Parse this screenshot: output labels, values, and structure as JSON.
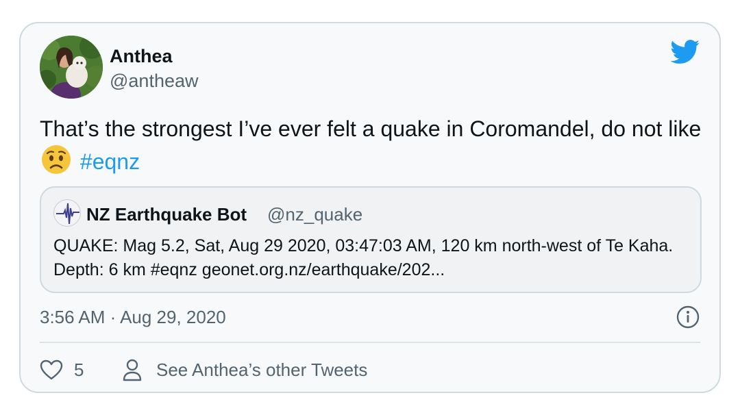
{
  "tweet": {
    "author_name": "Anthea",
    "author_handle": "@antheaw",
    "text_main": "That’s the strongest I’ve ever felt a quake in Coromandel, do not like",
    "emoji": "worried-face",
    "hashtag": "#eqnz",
    "timestamp": "3:56 AM · Aug 29, 2020"
  },
  "quote": {
    "author_name": "NZ Earthquake Bot",
    "author_handle": "@nz_quake",
    "text": "QUAKE: Mag 5.2, Sat, Aug 29 2020, 03:47:03 AM, 120 km north-west of Te Kaha. Depth: 6 km #eqnz geonet.org.nz/earthquake/202..."
  },
  "actions": {
    "like_count": "5",
    "other_tweets_label": "See Anthea’s other Tweets"
  },
  "icons": {
    "brand": "twitter-bird-icon",
    "info": "info-icon",
    "like": "heart-icon",
    "profile": "person-icon"
  },
  "colors": {
    "accent": "#1d9bf0",
    "card_background": "#f7f9fa",
    "border": "#cfd9de",
    "secondary_text": "#536471"
  }
}
